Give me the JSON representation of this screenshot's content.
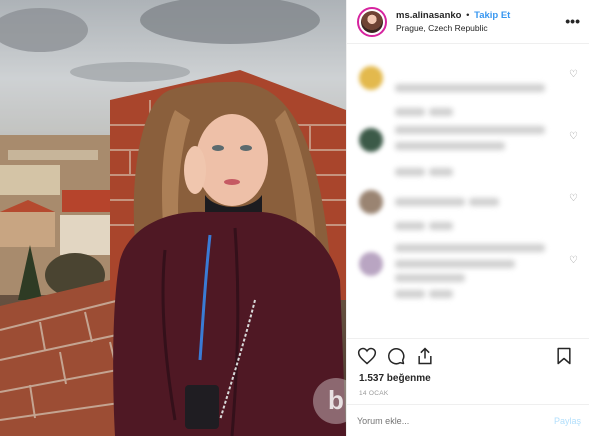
{
  "header": {
    "username": "ms.alinasanko",
    "separator": "•",
    "follow_label": "Takip Et",
    "location": "Prague, Czech Republic",
    "more_icon": "more-horizontal-icon"
  },
  "comments": [
    {
      "avatar_color": "#e3b94d",
      "lines": [
        [
          0,
          30,
          150
        ],
        [
          0,
          54,
          30
        ],
        [
          34,
          54,
          24
        ]
      ]
    },
    {
      "avatar_color": "#3c5a48",
      "lines": [
        [
          0,
          10,
          150
        ],
        [
          0,
          26,
          110
        ],
        [
          0,
          52,
          30
        ],
        [
          34,
          52,
          24
        ]
      ]
    },
    {
      "avatar_color": "#9a8472",
      "lines": [
        [
          0,
          20,
          70
        ],
        [
          74,
          20,
          30
        ],
        [
          0,
          44,
          30
        ],
        [
          34,
          44,
          24
        ]
      ]
    },
    {
      "avatar_color": "#b9a5c2",
      "lines": [
        [
          0,
          4,
          150
        ],
        [
          0,
          20,
          120
        ],
        [
          0,
          34,
          70
        ],
        [
          0,
          50,
          30
        ],
        [
          34,
          50,
          24
        ]
      ]
    }
  ],
  "actions": {
    "like_icon": "heart-icon",
    "comment_icon": "comment-icon",
    "share_icon": "share-icon",
    "save_icon": "bookmark-icon"
  },
  "likes": "1.537 beğenme",
  "date": "14 OCAK",
  "comment_box": {
    "placeholder": "Yorum ekle...",
    "post_label": "Paylaş"
  },
  "colors": {
    "accent": "#3897f0",
    "post_disabled": "#b2dffc",
    "brick": "#b4553a",
    "coat": "#5a1e2a"
  }
}
